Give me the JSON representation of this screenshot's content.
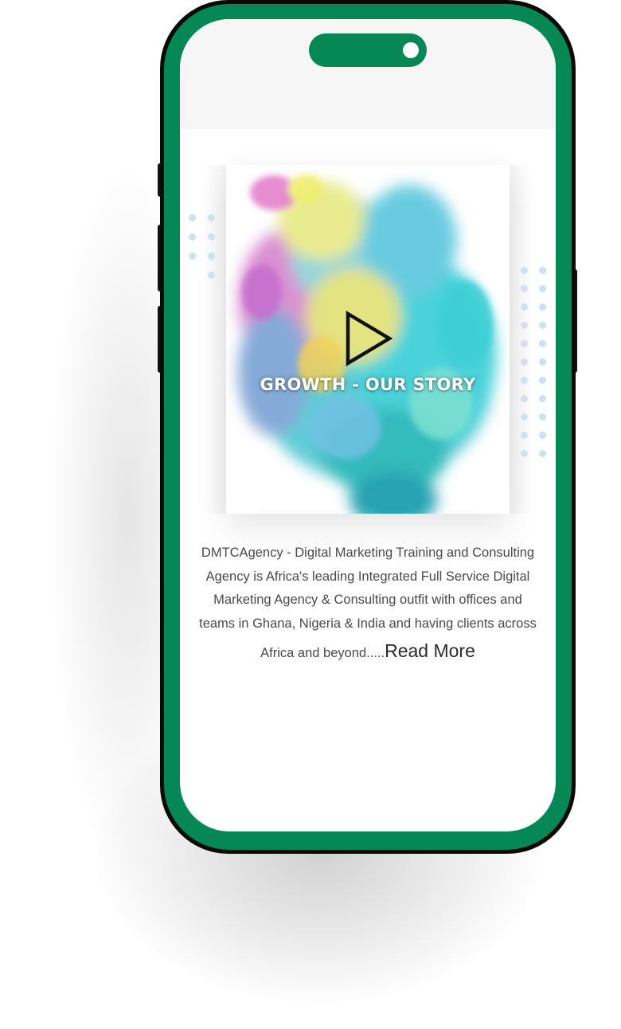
{
  "phone": {
    "frame_color": "#058756",
    "bezel_color": "#0a0a0a",
    "status_bg": "#f6f6f6"
  },
  "video_card": {
    "title": "GROWTH - OUR STORY",
    "play_icon": "play-icon",
    "background_art": "colorful-ink-cloud"
  },
  "about": {
    "description": "DMTCAgency - Digital Marketing Training and Consulting Agency is Africa's leading Integrated Full Service Digital Marketing Agency & Consulting outfit with offices and teams in Ghana, Nigeria & India and having clients across Africa and beyond.....",
    "read_more_label": "Read More"
  },
  "decor": {
    "dot_color": "#c9e3f2"
  }
}
